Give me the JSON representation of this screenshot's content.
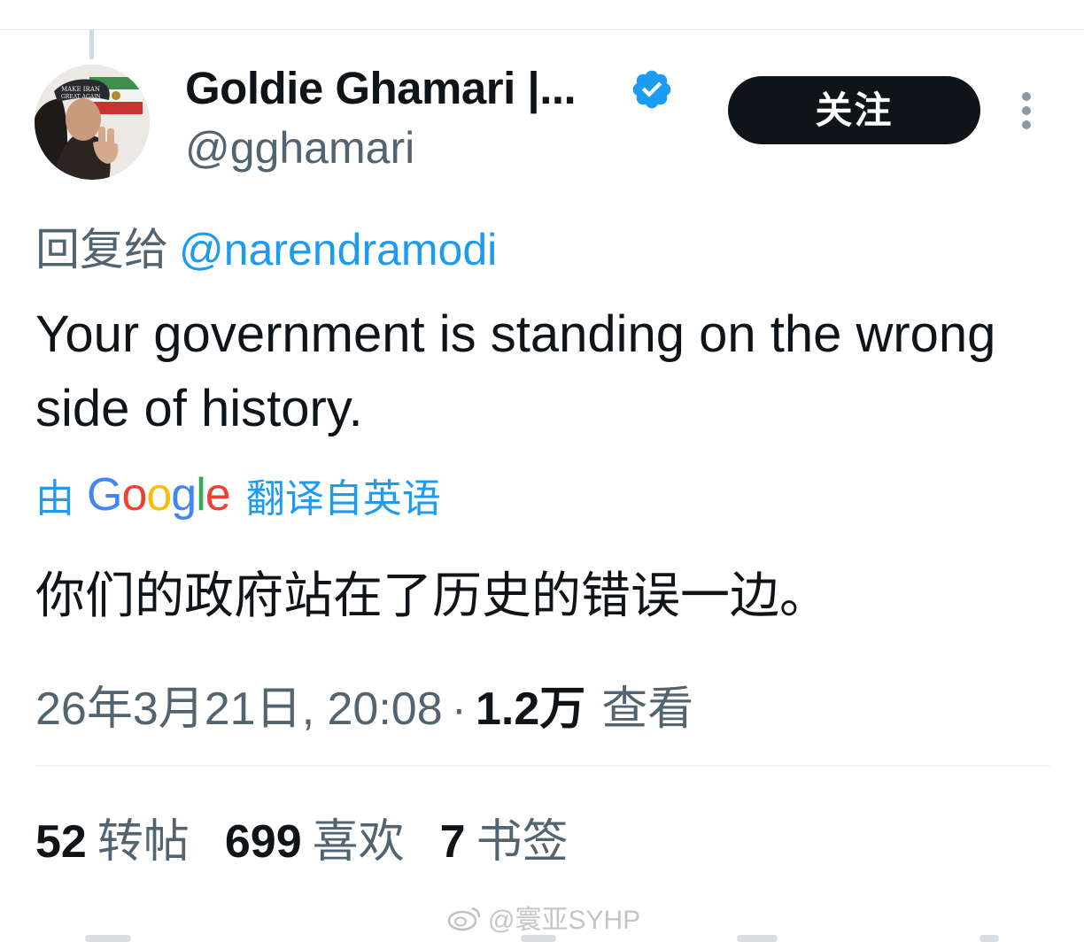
{
  "user": {
    "display_name": "Goldie Ghamari |...",
    "handle": "@gghamari",
    "verified_icon": "verified-badge-icon",
    "avatar_hat_text_1": "MAKE IRAN",
    "avatar_hat_text_2": "GREAT AGAIN"
  },
  "actions": {
    "follow_label": "关注",
    "more_icon": "more-vertical-icon"
  },
  "reply": {
    "prefix": "回复给",
    "handle": "@narendramodi"
  },
  "tweet": {
    "text": "Your government is standing on the wrong side of history."
  },
  "translation": {
    "prefix": "由",
    "suffix": "翻译自英语",
    "translated_text": "你们的政府站在了历史的错误一边。"
  },
  "meta": {
    "timestamp": "26年3月21日, 20:08",
    "separator": "·",
    "views_count": "1.2万",
    "views_label": "查看"
  },
  "stats": [
    {
      "count": "52",
      "label": "转帖"
    },
    {
      "count": "699",
      "label": "喜欢"
    },
    {
      "count": "7",
      "label": "书签"
    }
  ],
  "watermark": {
    "text": "@寰亚SYHP",
    "icon": "weibo-icon"
  },
  "colors": {
    "text_primary": "#0f1419",
    "text_secondary": "#536471",
    "link_blue": "#1d9bf0",
    "button_bg": "#0f1419"
  }
}
